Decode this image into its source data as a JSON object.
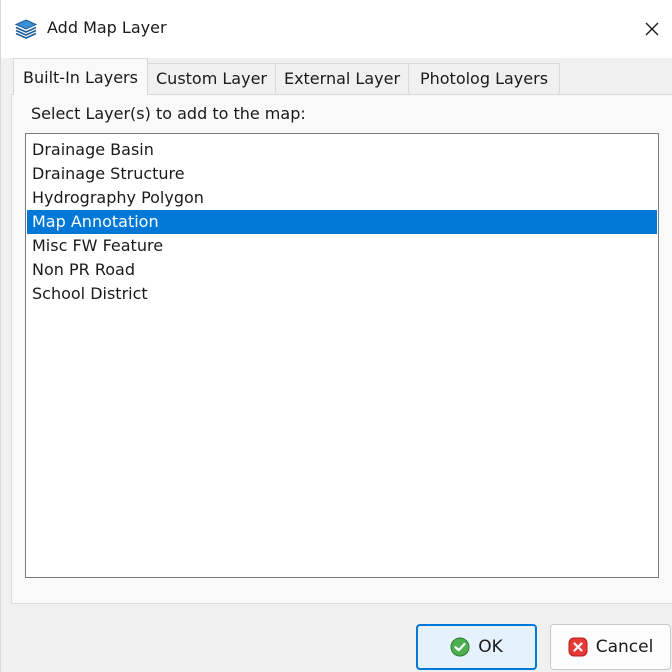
{
  "window": {
    "title": "Add Map Layer",
    "icon": "stacked-layers-icon"
  },
  "tabs": [
    {
      "label": "Built-In Layers",
      "active": true
    },
    {
      "label": "Custom Layer",
      "active": false
    },
    {
      "label": "External Layer",
      "active": false
    },
    {
      "label": "Photolog Layers",
      "active": false
    }
  ],
  "panel": {
    "prompt": "Select Layer(s) to add to the map:",
    "layers": [
      {
        "label": "Drainage Basin",
        "selected": false
      },
      {
        "label": "Drainage Structure",
        "selected": false
      },
      {
        "label": "Hydrography Polygon",
        "selected": false
      },
      {
        "label": "Map Annotation",
        "selected": true
      },
      {
        "label": "Misc FW Feature",
        "selected": false
      },
      {
        "label": "Non PR Road",
        "selected": false
      },
      {
        "label": "School District",
        "selected": false
      }
    ]
  },
  "buttons": {
    "ok_label": "OK",
    "ok_icon": "green-check-circle-icon",
    "cancel_label": "Cancel",
    "cancel_icon": "red-x-circle-icon"
  },
  "colors": {
    "selection": "#0078d7",
    "ok_icon": "#4caf50",
    "cancel_icon": "#e53935",
    "default_button_border": "#0078d7"
  }
}
